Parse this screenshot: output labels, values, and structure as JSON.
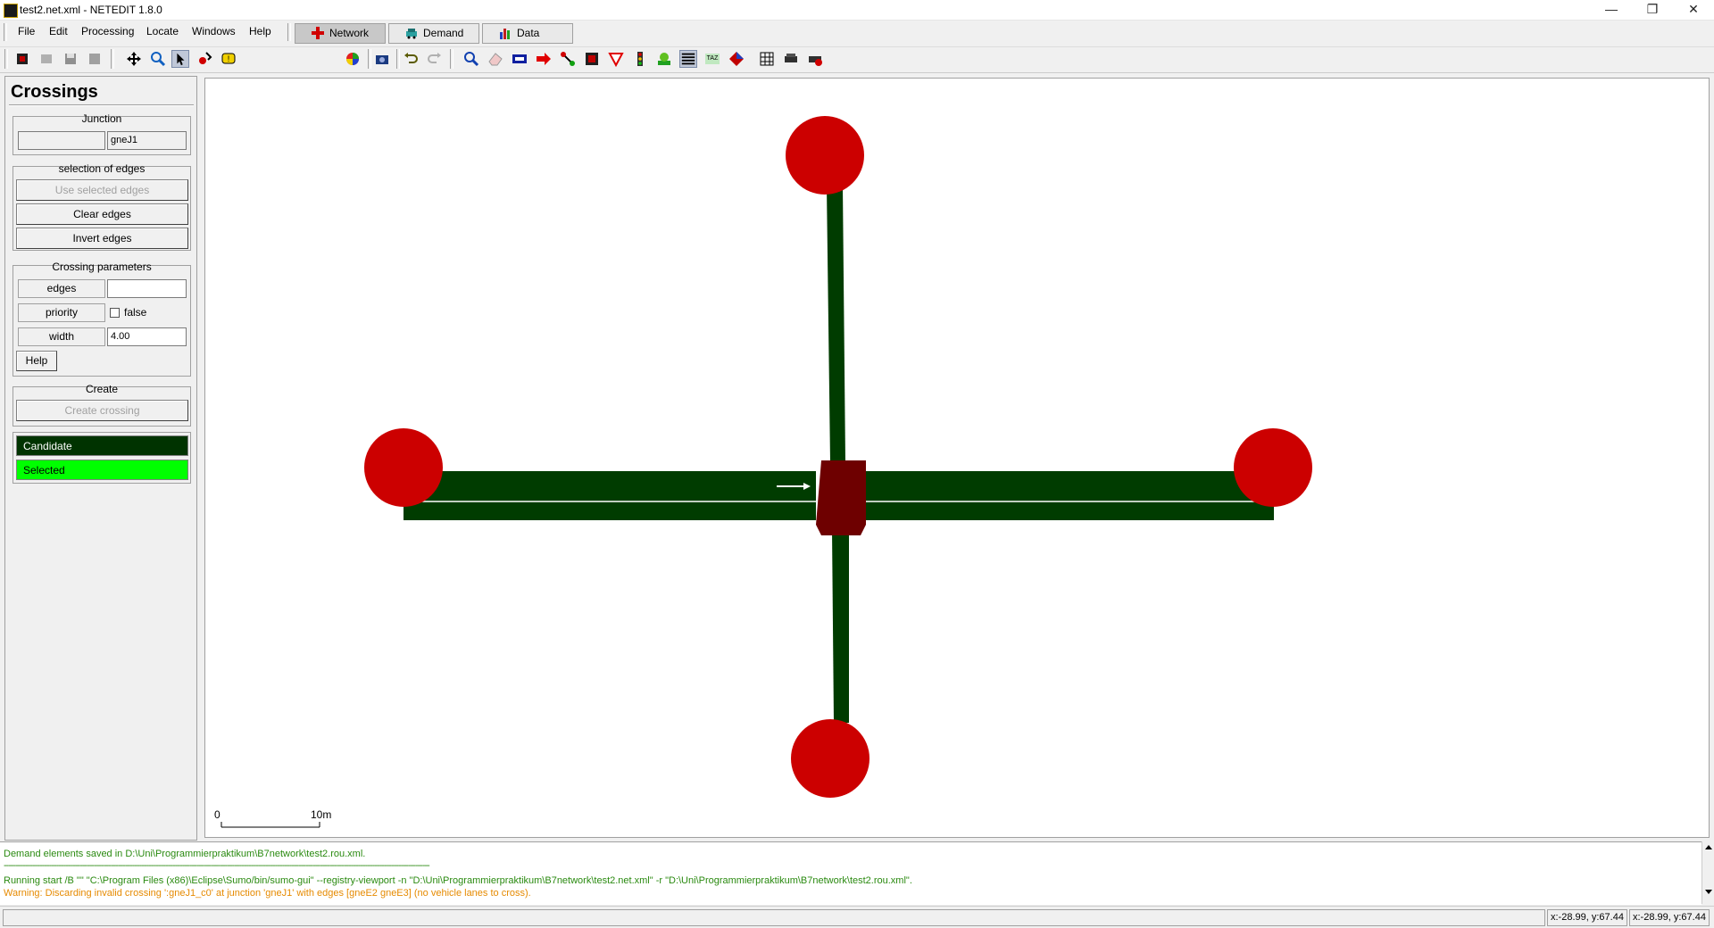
{
  "window": {
    "title": "test2.net.xml - NETEDIT 1.8.0",
    "controls": {
      "minimize": "—",
      "maximize": "❐",
      "close": "✕"
    }
  },
  "menu": {
    "items": [
      "File",
      "Edit",
      "Processing",
      "Locate",
      "Windows",
      "Help"
    ],
    "modes": [
      {
        "label": "Network",
        "icon": "network-plus-icon",
        "active": true
      },
      {
        "label": "Demand",
        "icon": "car-icon",
        "active": false
      },
      {
        "label": "Data",
        "icon": "bar-chart-icon",
        "active": false
      }
    ]
  },
  "toolbar": {
    "scheme": "standard"
  },
  "panel": {
    "title": "Crossings",
    "junction": {
      "heading": "Junction",
      "id": "gneJ1"
    },
    "edges_group": {
      "heading": "selection of edges",
      "use_selected": "Use selected edges",
      "clear": "Clear edges",
      "invert": "Invert edges"
    },
    "params": {
      "heading": "Crossing parameters",
      "edges_label": "edges",
      "edges_value": "",
      "priority_label": "priority",
      "priority_value": "false",
      "width_label": "width",
      "width_value": "4.00",
      "help": "Help"
    },
    "create": {
      "heading": "Create",
      "button": "Create crossing"
    },
    "legend": {
      "candidate": "Candidate",
      "selected": "Selected",
      "candidate_color": "#003300",
      "selected_color": "#00ff00"
    }
  },
  "canvas": {
    "scale_zero": "0",
    "scale_label": "10m",
    "edge_color": "#003c00",
    "junction_color": "#cc0000",
    "center_junction_color": "#6e0000"
  },
  "messages": [
    {
      "text": "Demand elements saved in D:\\Uni\\Programmierpraktikum\\B7network\\test2.rou.xml.",
      "kind": "green"
    },
    {
      "text": "-----------------------------------------------------------------------------------------------------------------------------------------------------------------------------------",
      "kind": "green"
    },
    {
      "text": "Running start /B \"\" \"C:\\Program Files (x86)\\Eclipse\\Sumo/bin/sumo-gui\" --registry-viewport -n \"D:\\Uni\\Programmierpraktikum\\B7network\\test2.net.xml\" -r \"D:\\Uni\\Programmierpraktikum\\B7network\\test2.rou.xml\".",
      "kind": "green"
    },
    {
      "text": "Warning: Discarding invalid crossing ':gneJ1_c0' at junction 'gneJ1' with edges [gneE2 gneE3] (no vehicle lanes to cross).",
      "kind": "orange"
    }
  ],
  "status": {
    "coords_1": "x:-28.99, y:67.44",
    "coords_2": "x:-28.99, y:67.44"
  }
}
